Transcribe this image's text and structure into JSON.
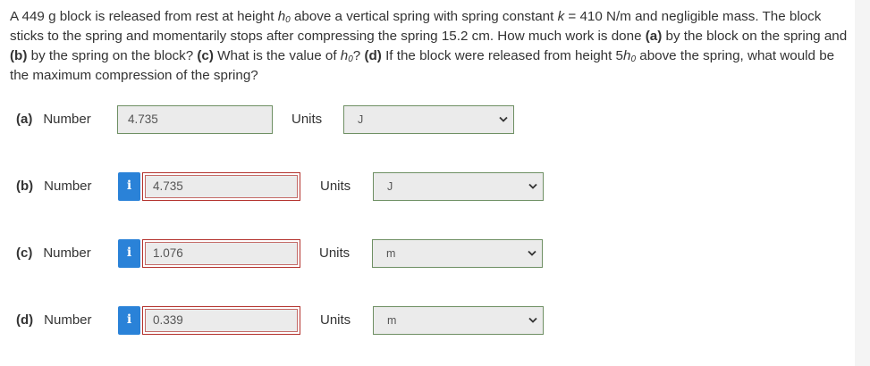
{
  "question": {
    "t1": "A 449 g block is released from rest at height ",
    "h0_a": "h",
    "h0_a_sub": "0",
    "t2": " above a vertical spring with spring constant ",
    "k_var": "k",
    "t3": " = 410 N/m and negligible mass. The block sticks to the spring and momentarily stops after compressing the spring 15.2 cm. How much work is done ",
    "pa": "(a)",
    "t4": " by the block on the spring and ",
    "pb": "(b)",
    "t5": " by the spring on the block? ",
    "pc": "(c)",
    "t6": " What is the value of ",
    "h0_b": "h",
    "h0_b_sub": "0",
    "t7": "? ",
    "pd": "(d)",
    "t8": " If the block were released from height 5",
    "h0_c": "h",
    "h0_c_sub": "0",
    "t9": " above the spring, what would be the maximum compression of the spring?"
  },
  "parts": [
    {
      "part": "(a)",
      "label": "Number",
      "value": "4.735",
      "units_label": "Units",
      "unit": "J",
      "status": "neutral"
    },
    {
      "part": "(b)",
      "label": "Number",
      "info": "i",
      "value": "4.735",
      "units_label": "Units",
      "unit": "J",
      "status": "incorrect"
    },
    {
      "part": "(c)",
      "label": "Number",
      "info": "i",
      "value": "1.076",
      "units_label": "Units",
      "unit": "m",
      "status": "incorrect"
    },
    {
      "part": "(d)",
      "label": "Number",
      "info": "i",
      "value": "0.339",
      "units_label": "Units",
      "unit": "m",
      "status": "incorrect"
    }
  ],
  "colors": {
    "info_badge": "#2a82d8",
    "incorrect_border": "#b3312c",
    "field_border": "#6e8f63",
    "field_bg": "#ebebeb"
  },
  "icons": {
    "info": "info-icon",
    "dropdown": "chevron-down-icon"
  }
}
